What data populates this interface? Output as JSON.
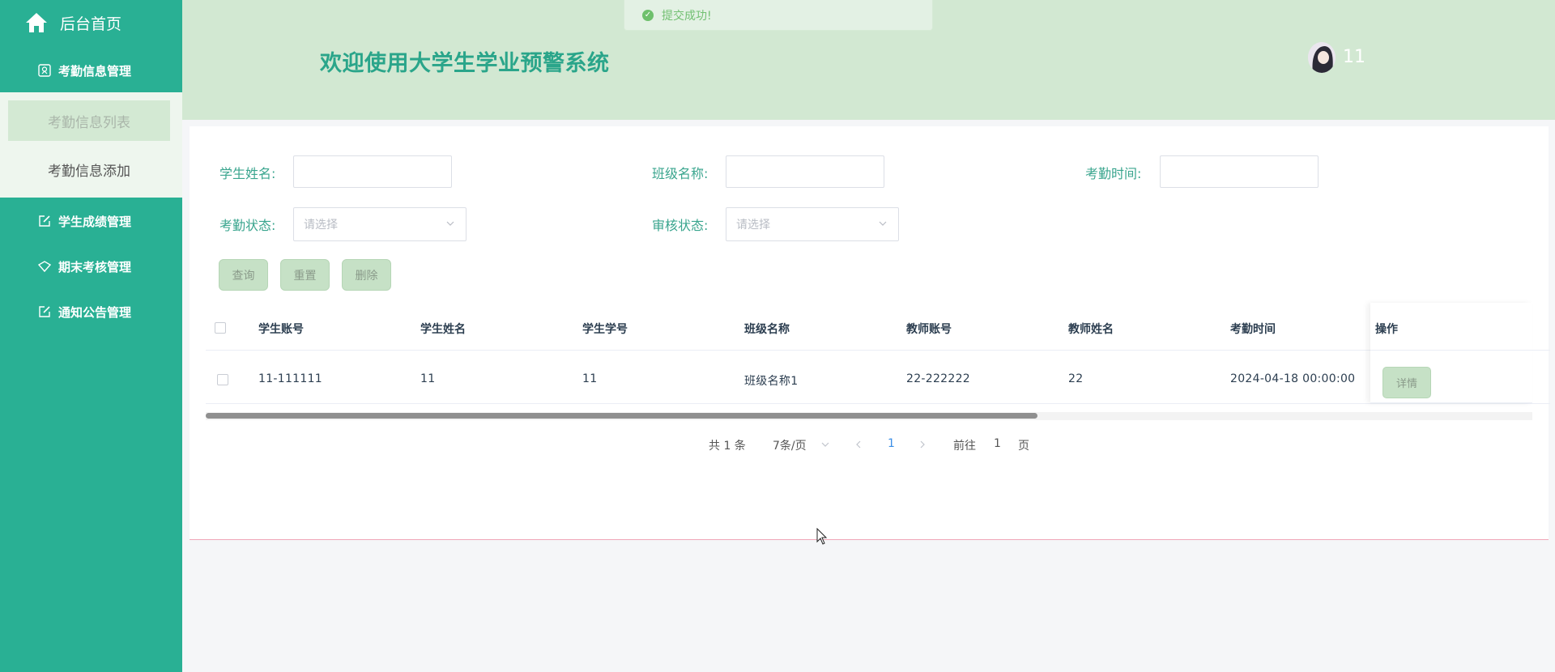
{
  "sidebar": {
    "home_label": "后台首页",
    "groups": [
      {
        "label": "考勤信息管理",
        "icon": "badge-icon"
      },
      {
        "label": "学生成绩管理",
        "icon": "edit-icon"
      },
      {
        "label": "期末考核管理",
        "icon": "gem-icon"
      },
      {
        "label": "通知公告管理",
        "icon": "edit-icon"
      }
    ],
    "submenu": [
      {
        "label": "考勤信息列表",
        "active": true
      },
      {
        "label": "考勤信息添加",
        "active": false
      }
    ]
  },
  "header": {
    "title": "欢迎使用大学生学业预警系统",
    "username": "11",
    "toast": "提交成功!"
  },
  "filters": {
    "student_name_label": "学生姓名:",
    "class_name_label": "班级名称:",
    "attendance_time_label": "考勤时间:",
    "attendance_status_label": "考勤状态:",
    "review_status_label": "审核状态:",
    "select_placeholder": "请选择"
  },
  "buttons": {
    "query": "查询",
    "reset": "重置",
    "delete": "删除"
  },
  "table": {
    "columns": [
      "学生账号",
      "学生姓名",
      "学生学号",
      "班级名称",
      "教师账号",
      "教师姓名",
      "考勤时间",
      "操作"
    ],
    "rows": [
      [
        "11-111111",
        "11",
        "11",
        "班级名称1",
        "22-222222",
        "22",
        "2024-04-18 00:00:00"
      ]
    ],
    "detail_label": "详情"
  },
  "pagination": {
    "total": "共 1 条",
    "page_size": "7条/页",
    "current_page": "1",
    "goto_label": "前往",
    "goto_value": "1",
    "page_suffix": "页"
  },
  "colors": {
    "sidebar": "#29b094",
    "header": "#d2e8d2",
    "accent": "#2aa58a",
    "button": "#c6e1c6"
  }
}
